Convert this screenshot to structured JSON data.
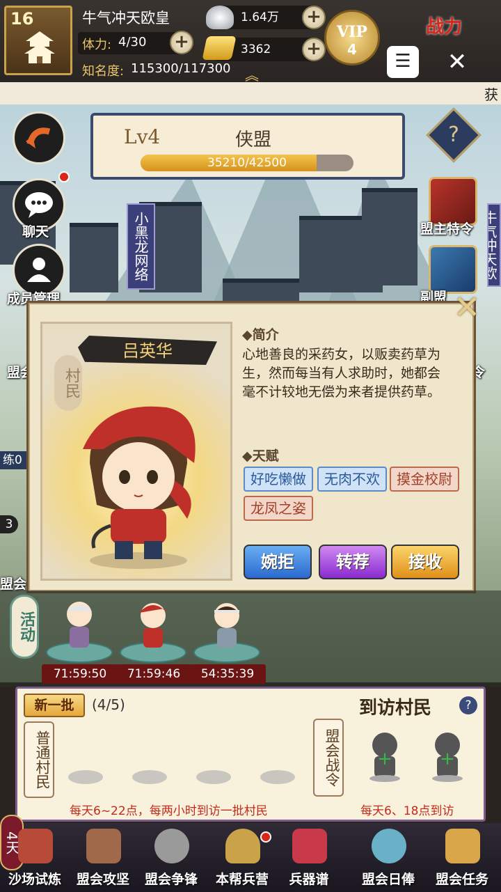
{
  "header": {
    "level": "16",
    "player_name": "牛气冲天欧皇",
    "stamina_label": "体力:",
    "stamina_value": "4/30",
    "fame_label": "知名度:",
    "fame_value": "115300/117300",
    "silver": "1.64万",
    "gold": "3362",
    "vip_label": "VIP",
    "vip_level": "4",
    "power_label": "战力",
    "menu_glyph": "☰",
    "close_glyph": "✕",
    "marquee_text": "获"
  },
  "league": {
    "level_text": "Lv4",
    "name": "侠盟",
    "xp_text": "35210/42500",
    "xp_fraction": 0.828,
    "help_glyph": "?"
  },
  "left_menu": {
    "chat": "聊天",
    "members": "成员管理",
    "alliance": "盟会",
    "train_prefix": "练",
    "train_value": "0",
    "count": "3",
    "bottom": "盟会"
  },
  "right_menu": {
    "leader_order": "盟主特令",
    "second": "副盟",
    "third": "令"
  },
  "vertical_banners": {
    "left": "小黑龙网络",
    "right": "牛气冲天欧皇"
  },
  "villager": {
    "name": "吕英华",
    "role": "村民",
    "intro_title": "◆简介",
    "intro_text": "心地善良的采药女，以贩卖药草为生，然而每当有人求助时，她都会毫不计较地无偿为来者提供药草。",
    "talent_title": "◆天赋",
    "talents": [
      {
        "label": "好吃懒做",
        "tone": "blue"
      },
      {
        "label": "无肉不欢",
        "tone": "blue"
      },
      {
        "label": "摸金校尉",
        "tone": "red"
      },
      {
        "label": "龙凤之姿",
        "tone": "red"
      }
    ],
    "actions": {
      "decline": "婉拒",
      "recommend": "转荐",
      "accept": "接收"
    }
  },
  "activity": {
    "tag": "活动",
    "timers": [
      "71:59:50",
      "71:59:46",
      "54:35:39"
    ]
  },
  "visit_panel": {
    "new_batch": "新一批",
    "count": "(4/5)",
    "title": "到访村民",
    "help": "?",
    "normal_tag": "普通村民",
    "war_tag": "盟会战令",
    "plus": "+",
    "hint_left": "每天6~22点，每两小时到访一批村民",
    "hint_right": "每天6、18点到访"
  },
  "days_badge": "4天",
  "nav": [
    {
      "label": "沙场试炼",
      "color": "#b84a3a"
    },
    {
      "label": "盟会攻坚",
      "color": "#a06a4a"
    },
    {
      "label": "盟会争锋",
      "color": "#9a9a9a"
    },
    {
      "label": "本帮兵营",
      "color": "#c9a24a"
    },
    {
      "label": "兵器谱",
      "color": "#c83a4a"
    },
    {
      "label": "",
      "color": "#2a2430"
    },
    {
      "label": "盟会日俸",
      "color": "#6ab0c8"
    },
    {
      "label": "盟会任务",
      "color": "#d9a64a"
    }
  ]
}
